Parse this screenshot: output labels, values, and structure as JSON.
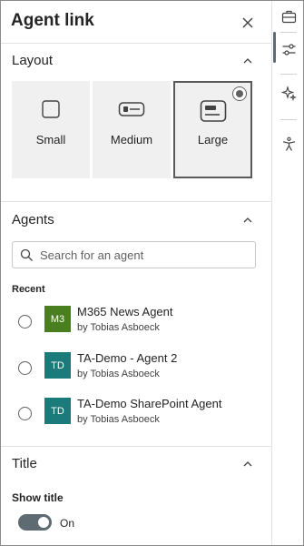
{
  "panel": {
    "title": "Agent link",
    "close_icon": "close-icon"
  },
  "layout_section": {
    "title": "Layout",
    "options": [
      {
        "label": "Small",
        "icon": "square-icon",
        "selected": false
      },
      {
        "label": "Medium",
        "icon": "medium-card-icon",
        "selected": false
      },
      {
        "label": "Large",
        "icon": "large-card-icon",
        "selected": true
      }
    ]
  },
  "agents_section": {
    "title": "Agents",
    "search_placeholder": "Search for an agent",
    "recent_label": "Recent",
    "agents": [
      {
        "name": "M365 News Agent",
        "author": "by Tobias Asboeck",
        "avatar_text": "M3",
        "avatar_color": "#4a7f1f"
      },
      {
        "name": "TA-Demo - Agent 2",
        "author": "by Tobias Asboeck",
        "avatar_text": "TD",
        "avatar_color": "#1b7b7b"
      },
      {
        "name": "TA-Demo SharePoint Agent",
        "author": "by Tobias Asboeck",
        "avatar_text": "TD",
        "avatar_color": "#1b7b7b"
      }
    ]
  },
  "title_section": {
    "title": "Title",
    "show_title_label": "Show title",
    "toggle_state": "On",
    "toggle_on": true
  },
  "rail": {
    "items": [
      "toolbox-icon",
      "settings-sliders-icon",
      "sparkle-icon",
      "accessibility-icon"
    ]
  },
  "colors": {
    "accent": "#5f6b73",
    "tile_bg": "#f0f0f0",
    "divider": "#e1e1e1"
  }
}
